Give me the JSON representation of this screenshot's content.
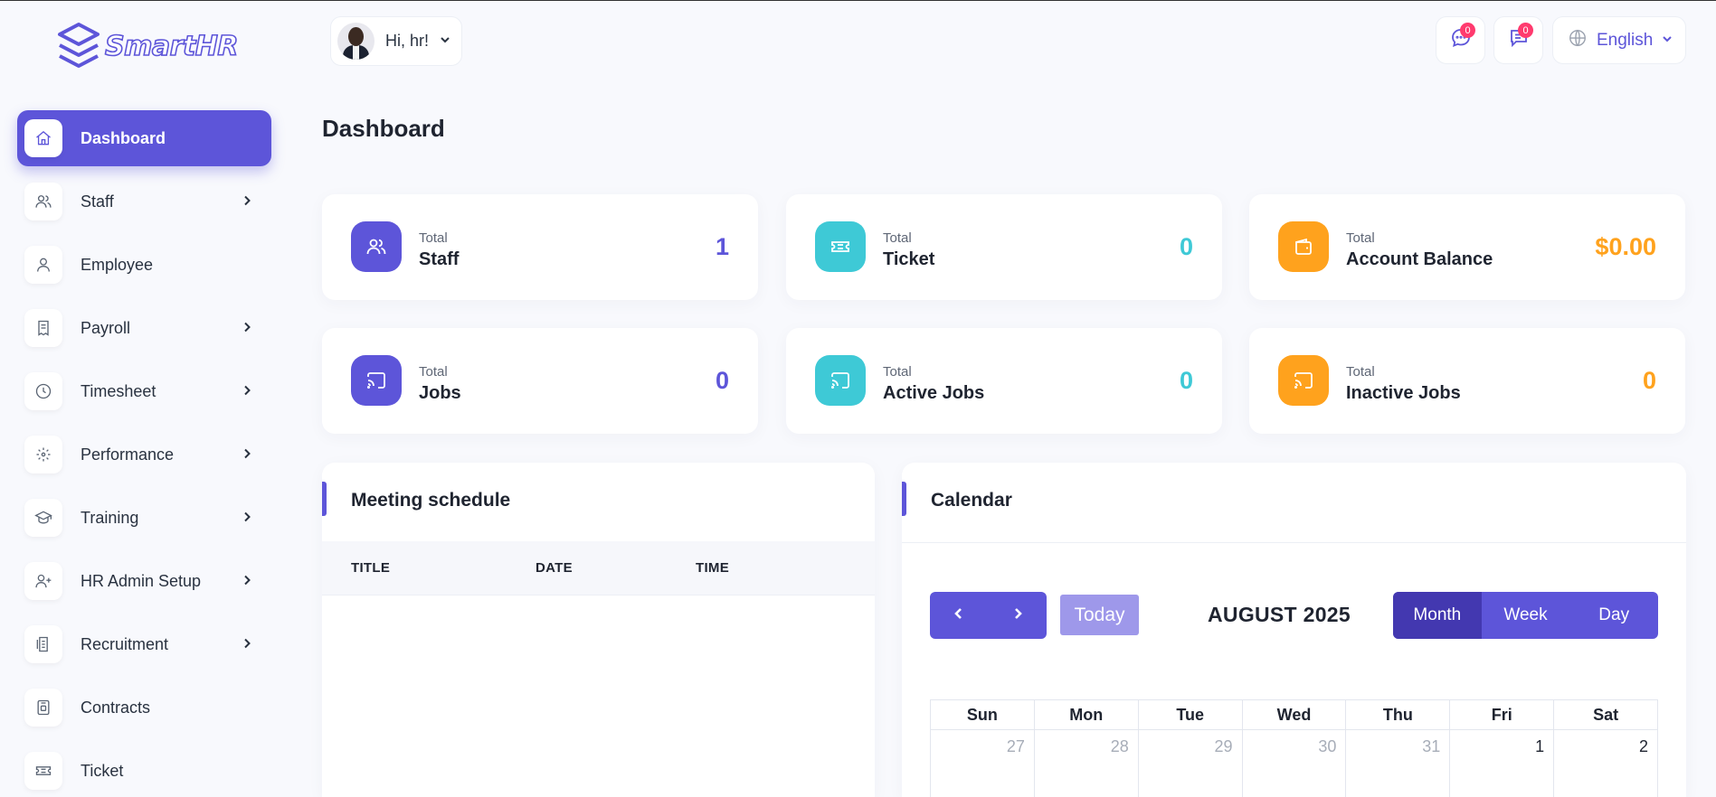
{
  "brand": {
    "name": "SmartHR"
  },
  "sidebar": {
    "items": [
      {
        "label": "Dashboard",
        "icon": "home-icon",
        "active": true,
        "has_children": false
      },
      {
        "label": "Staff",
        "icon": "users-icon",
        "has_children": true
      },
      {
        "label": "Employee",
        "icon": "user-icon",
        "has_children": false
      },
      {
        "label": " Payroll",
        "icon": "receipt-icon",
        "has_children": true
      },
      {
        "label": "Timesheet",
        "icon": "clock-icon",
        "has_children": true
      },
      {
        "label": "Performance",
        "icon": "focus-icon",
        "has_children": true
      },
      {
        "label": "Training",
        "icon": "graduation-cap-icon",
        "has_children": true
      },
      {
        "label": " HR Admin Setup",
        "icon": "user-plus-icon",
        "has_children": true
      },
      {
        "label": "Recruitment",
        "icon": "document-icon",
        "has_children": true
      },
      {
        "label": "Contracts",
        "icon": "contract-icon",
        "has_children": false
      },
      {
        "label": "Ticket",
        "icon": "ticket-icon",
        "has_children": false
      }
    ]
  },
  "header": {
    "greeting": "Hi, hr!",
    "messages_count": "0",
    "notifications_count": "0",
    "language": "English"
  },
  "page": {
    "title": "Dashboard"
  },
  "stats": [
    {
      "small": "Total",
      "label": "Staff",
      "value": "1",
      "color": "#5d55d9",
      "icon": "users-icon"
    },
    {
      "small": "Total",
      "label": "Ticket",
      "value": "0",
      "color": "#3ec9d6",
      "icon": "ticket-icon"
    },
    {
      "small": "Total",
      "label": "Account Balance",
      "value": "$0.00",
      "color": "#ffa21d",
      "icon": "wallet-icon"
    },
    {
      "small": "Total",
      "label": "Jobs",
      "value": "0",
      "color": "#5d55d9",
      "icon": "cast-icon"
    },
    {
      "small": "Total",
      "label": "Active Jobs",
      "value": "0",
      "color": "#3ec9d6",
      "icon": "cast-icon"
    },
    {
      "small": "Total",
      "label": "Inactive Jobs",
      "value": "0",
      "color": "#ffa21d",
      "icon": "cast-icon"
    }
  ],
  "meeting": {
    "title": "Meeting schedule",
    "columns": [
      "TITLE",
      "DATE",
      "TIME"
    ]
  },
  "calendar": {
    "title": "Calendar",
    "today_label": "Today",
    "month_label": "AUGUST 2025",
    "views": [
      "Month",
      "Week",
      "Day"
    ],
    "active_view": "Month",
    "weekdays": [
      "Sun",
      "Mon",
      "Tue",
      "Wed",
      "Thu",
      "Fri",
      "Sat"
    ],
    "first_row": [
      {
        "day": "27",
        "muted": true
      },
      {
        "day": "28",
        "muted": true
      },
      {
        "day": "29",
        "muted": true
      },
      {
        "day": "30",
        "muted": true
      },
      {
        "day": "31",
        "muted": true
      },
      {
        "day": "1",
        "muted": false
      },
      {
        "day": "2",
        "muted": false
      }
    ]
  },
  "colors": {
    "accent": "#5d55d9",
    "cyan": "#3ec9d6",
    "orange": "#ffa21d",
    "badge": "#ff3a6e"
  }
}
